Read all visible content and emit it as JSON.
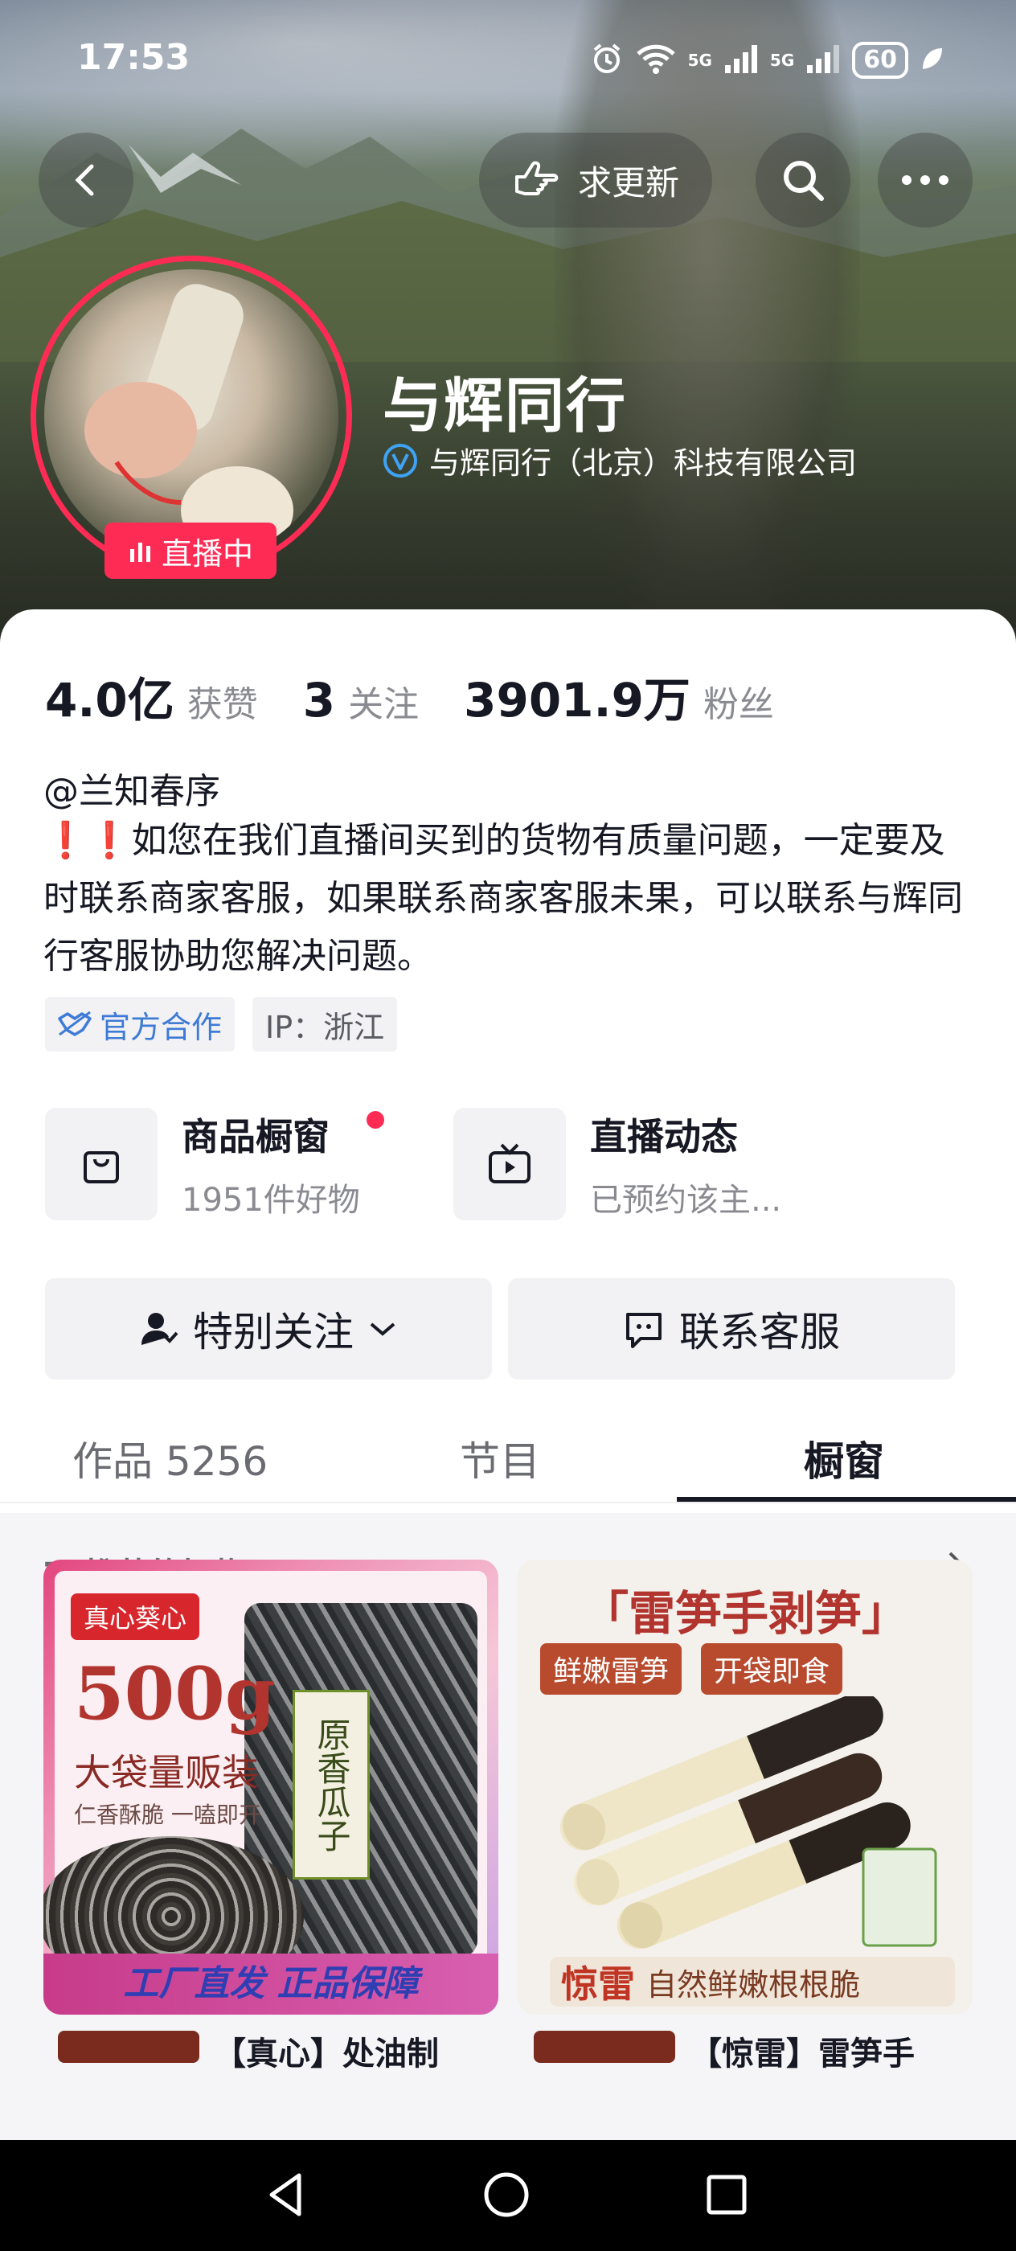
{
  "status_bar": {
    "time": "17:53",
    "net1": "5G",
    "net2": "5G",
    "battery": "60"
  },
  "header": {
    "update_label": "求更新"
  },
  "profile": {
    "name": "与辉同行",
    "verified_text": "与辉同行（北京）科技有限公司",
    "live_badge": "直播中",
    "stats": [
      {
        "value": "4.0亿",
        "label": "获赞"
      },
      {
        "value": "3",
        "label": "关注"
      },
      {
        "value": "3901.9万",
        "label": "粉丝"
      }
    ],
    "handle": "@兰知春序",
    "bio_alert": "❗❗",
    "bio": "如您在我们直播间买到的货物有质量问题，一定要及时联系商家客服，如果联系商家客服未果，可以联系与辉同行客服协助您解决问题。",
    "tags": {
      "official": "官方合作",
      "ip": "IP：浙江"
    }
  },
  "services": {
    "shop": {
      "title": "商品橱窗",
      "subtitle": "1951件好物"
    },
    "live": {
      "title": "直播动态",
      "subtitle": "已预约该主..."
    }
  },
  "actions": {
    "follow": "特别关注",
    "contact": "联系客服"
  },
  "tabs": [
    {
      "label": "作品 5256"
    },
    {
      "label": "节目"
    },
    {
      "label": "橱窗",
      "active": true
    }
  ],
  "recommend": {
    "title": "Ta推荐的好物",
    "products": [
      {
        "brand": "真心葵心",
        "weight": "500g",
        "line1": "大袋量贩装",
        "line2": "仁香酥脆 一嗑即开",
        "pack_label": "原香瓜子",
        "footer": "工厂直发 正品保障",
        "name_partial": "【真心】处油制"
      },
      {
        "title": "「雷笋手剥笋」",
        "chip1": "鲜嫩雷笋",
        "chip2": "开袋即食",
        "footer_brand": "惊雷",
        "footer_text": "自然鲜嫩根根脆",
        "name_partial": "【惊雷】雷笋手"
      }
    ]
  },
  "colors": {
    "accent": "#fe2c55",
    "official_blue": "#3e7bd6",
    "verify_blue": "#3ea3f5"
  }
}
